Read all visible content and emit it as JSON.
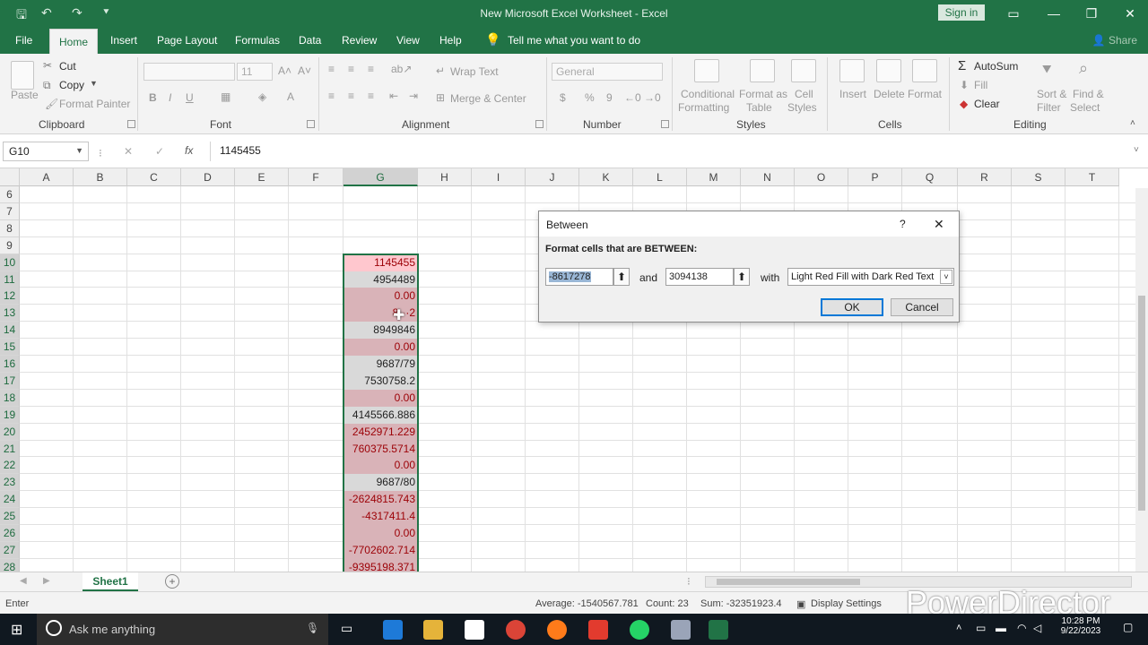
{
  "window": {
    "title": "New Microsoft Excel Worksheet  -  Excel",
    "sign_in": "Sign in"
  },
  "tabs": {
    "file": "File",
    "home": "Home",
    "insert": "Insert",
    "page_layout": "Page Layout",
    "formulas": "Formulas",
    "data": "Data",
    "review": "Review",
    "view": "View",
    "help": "Help",
    "tell_me": "Tell me what you want to do",
    "share": "Share"
  },
  "ribbon": {
    "paste": "Paste",
    "cut": "Cut",
    "copy": "Copy",
    "format_painter": "Format Painter",
    "clipboard": "Clipboard",
    "font_size": "11",
    "font": "Font",
    "bold": "B",
    "italic": "I",
    "underline": "U",
    "wrap_text": "Wrap Text",
    "merge_center": "Merge & Center",
    "alignment": "Alignment",
    "number_format": "General",
    "dollar": "$",
    "percent": "%",
    "comma": "9",
    "number": "Number",
    "cond_fmt_1": "Conditional",
    "cond_fmt_2": "Formatting",
    "fmt_table_1": "Format as",
    "fmt_table_2": "Table",
    "cell_styles_1": "Cell",
    "cell_styles_2": "Styles",
    "styles": "Styles",
    "insert": "Insert",
    "delete": "Delete",
    "format": "Format",
    "cells": "Cells",
    "autosum": "AutoSum",
    "fill": "Fill",
    "clear": "Clear",
    "sort_1": "Sort &",
    "sort_2": "Filter",
    "find_1": "Find &",
    "find_2": "Select",
    "editing": "Editing"
  },
  "formula_bar": {
    "name_box": "G10",
    "cancel": "✕",
    "enter": "✓",
    "fx": "fx",
    "value": "1145455"
  },
  "columns": [
    "A",
    "B",
    "C",
    "D",
    "E",
    "F",
    "G",
    "H",
    "I",
    "J",
    "K",
    "L",
    "M",
    "N",
    "O",
    "P",
    "Q",
    "R",
    "S",
    "T"
  ],
  "rows": [
    "6",
    "7",
    "8",
    "9",
    "10",
    "11",
    "12",
    "13",
    "14",
    "15",
    "16",
    "17",
    "18",
    "19",
    "20",
    "21",
    "22",
    "23",
    "24",
    "25",
    "26",
    "27",
    "28"
  ],
  "cells_g": [
    "",
    "",
    "",
    "",
    "1145455",
    "4954489",
    "0.00",
    "8···2",
    "8949846",
    "0.00",
    "9687/79",
    "7530758.2",
    "0.00",
    "4145566.886",
    "2452971.229",
    "760375.5714",
    "0.00",
    "9687/80",
    "-2624815.743",
    "-4317411.4",
    "0.00",
    "-7702602.714",
    "-9395198.371"
  ],
  "dialog": {
    "title": "Between",
    "help": "?",
    "close": "✕",
    "prompt": "Format cells that are BETWEEN:",
    "low": "-8617278",
    "and": "and",
    "high": "3094138",
    "with": "with",
    "format_choice": "Light Red Fill with Dark Red Text",
    "ok": "OK",
    "cancel": "Cancel"
  },
  "sheets": {
    "active": "Sheet1",
    "add": "+"
  },
  "status": {
    "mode": "Enter",
    "average": "Average: -1540567.781",
    "count": "Count: 23",
    "sum": "Sum: -32351923.4",
    "display_settings": "Display Settings"
  },
  "watermark": "PowerDirector",
  "taskbar": {
    "search": "Ask me anything",
    "time": "10:28 PM",
    "date": "9/22/2023"
  }
}
